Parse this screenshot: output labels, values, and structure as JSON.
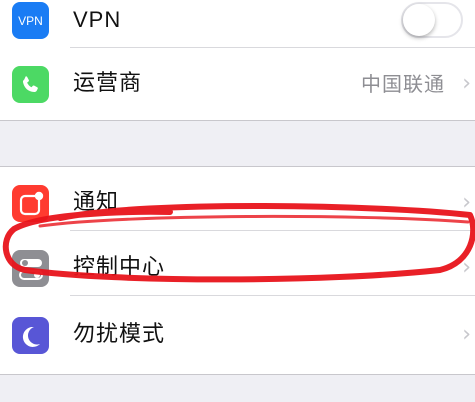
{
  "colors": {
    "vpn": "#1a7cf4",
    "carrier": "#4cd964",
    "notifications": "#ff3b30",
    "control_center": "#8e8e93",
    "dnd": "#5856d6",
    "annotation": "#e8141b"
  },
  "group1": {
    "vpn": {
      "label": "VPN",
      "icon_text": "VPN",
      "icon": "vpn-icon",
      "toggle_on": false
    },
    "carrier": {
      "label": "运营商",
      "value": "中国联通",
      "icon": "phone-icon",
      "chevron": "›"
    }
  },
  "group2": {
    "notifications": {
      "label": "通知",
      "icon": "notifications-icon",
      "chevron": "›"
    },
    "control_center": {
      "label": "控制中心",
      "icon": "control-center-icon",
      "chevron": "›"
    },
    "dnd": {
      "label": "勿扰模式",
      "icon": "moon-icon",
      "chevron": "›"
    }
  }
}
